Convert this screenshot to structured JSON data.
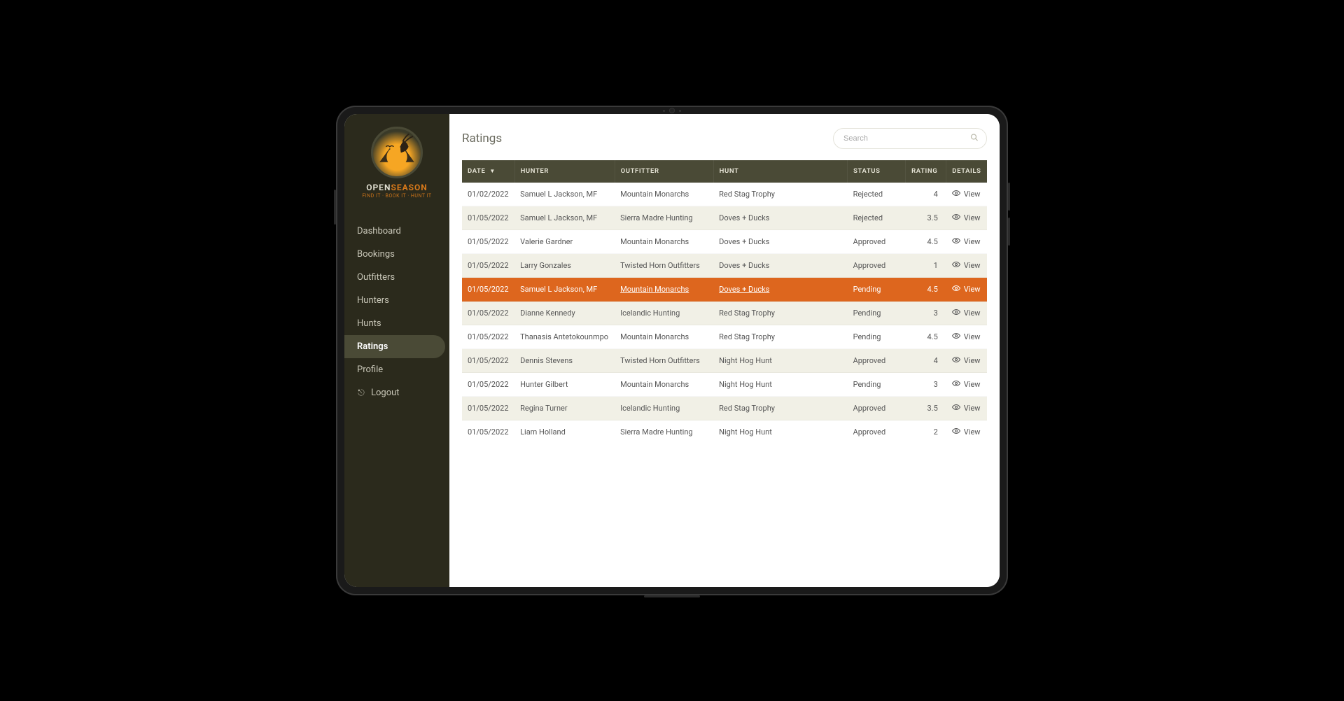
{
  "brand": {
    "word1": "OPEN",
    "word2": "SEASON",
    "tagline": "FIND IT · BOOK IT · HUNT IT"
  },
  "sidebar": {
    "items": [
      {
        "key": "dashboard",
        "label": "Dashboard",
        "active": false,
        "glyph": ""
      },
      {
        "key": "bookings",
        "label": "Bookings",
        "active": false,
        "glyph": ""
      },
      {
        "key": "outfitters",
        "label": "Outfitters",
        "active": false,
        "glyph": ""
      },
      {
        "key": "hunters",
        "label": "Hunters",
        "active": false,
        "glyph": ""
      },
      {
        "key": "hunts",
        "label": "Hunts",
        "active": false,
        "glyph": ""
      },
      {
        "key": "ratings",
        "label": "Ratings",
        "active": true,
        "glyph": ""
      },
      {
        "key": "profile",
        "label": "Profile",
        "active": false,
        "glyph": ""
      },
      {
        "key": "logout",
        "label": "Logout",
        "active": false,
        "glyph": "⎋"
      }
    ]
  },
  "page": {
    "title": "Ratings"
  },
  "search": {
    "placeholder": "Search",
    "value": ""
  },
  "table": {
    "columns": {
      "date": "DATE",
      "hunter": "HUNTER",
      "outfitter": "OUTFITTER",
      "hunt": "HUNT",
      "status": "STATUS",
      "rating": "RATING",
      "details": "DETAILS"
    },
    "sort": {
      "column": "date",
      "direction": "desc",
      "glyph": "▼"
    },
    "view_label": "View",
    "rows": [
      {
        "date": "01/02/2022",
        "hunter": "Samuel L Jackson, MF",
        "outfitter": "Mountain Monarchs",
        "hunt": "Red Stag Trophy",
        "status": "Rejected",
        "rating": "4",
        "highlight": false
      },
      {
        "date": "01/05/2022",
        "hunter": "Samuel L Jackson, MF",
        "outfitter": "Sierra Madre Hunting",
        "hunt": "Doves + Ducks",
        "status": "Rejected",
        "rating": "3.5",
        "highlight": false
      },
      {
        "date": "01/05/2022",
        "hunter": "Valerie Gardner",
        "outfitter": "Mountain Monarchs",
        "hunt": "Doves + Ducks",
        "status": "Approved",
        "rating": "4.5",
        "highlight": false
      },
      {
        "date": "01/05/2022",
        "hunter": "Larry Gonzales",
        "outfitter": "Twisted Horn Outfitters",
        "hunt": "Doves + Ducks",
        "status": "Approved",
        "rating": "1",
        "highlight": false
      },
      {
        "date": "01/05/2022",
        "hunter": "Samuel L Jackson, MF",
        "outfitter": "Mountain Monarchs",
        "hunt": "Doves + Ducks",
        "status": "Pending",
        "rating": "4.5",
        "highlight": true
      },
      {
        "date": "01/05/2022",
        "hunter": "Dianne Kennedy",
        "outfitter": "Icelandic Hunting",
        "hunt": "Red Stag Trophy",
        "status": "Pending",
        "rating": "3",
        "highlight": false
      },
      {
        "date": "01/05/2022",
        "hunter": "Thanasis Antetokounmpo",
        "outfitter": "Mountain Monarchs",
        "hunt": "Red Stag Trophy",
        "status": "Pending",
        "rating": "4.5",
        "highlight": false
      },
      {
        "date": "01/05/2022",
        "hunter": "Dennis Stevens",
        "outfitter": "Twisted Horn Outfitters",
        "hunt": "Night Hog Hunt",
        "status": "Approved",
        "rating": "4",
        "highlight": false
      },
      {
        "date": "01/05/2022",
        "hunter": "Hunter Gilbert",
        "outfitter": "Mountain Monarchs",
        "hunt": "Night Hog Hunt",
        "status": "Pending",
        "rating": "3",
        "highlight": false
      },
      {
        "date": "01/05/2022",
        "hunter": "Regina Turner",
        "outfitter": "Icelandic Hunting",
        "hunt": "Red Stag Trophy",
        "status": "Approved",
        "rating": "3.5",
        "highlight": false
      },
      {
        "date": "01/05/2022",
        "hunter": "Liam Holland",
        "outfitter": "Sierra Madre Hunting",
        "hunt": "Night Hog Hunt",
        "status": "Approved",
        "rating": "2",
        "highlight": false
      }
    ]
  },
  "colors": {
    "sidebar_bg": "#2b2a1c",
    "header_bg": "#4a4a36",
    "highlight": "#dd661e",
    "stripe": "#f1f0e6"
  }
}
